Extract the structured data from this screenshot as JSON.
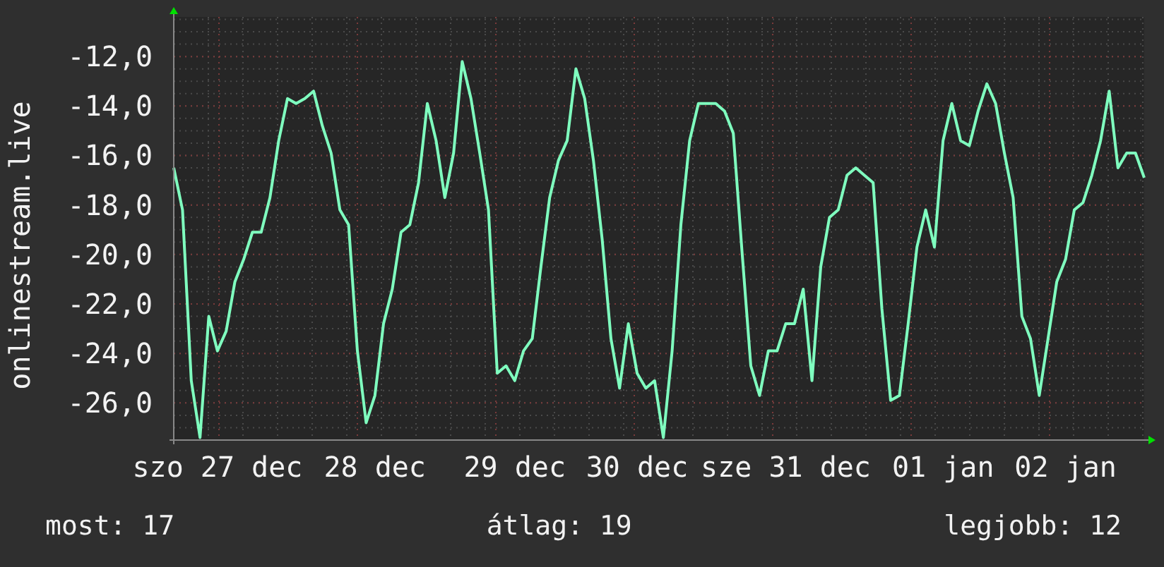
{
  "chart_data": {
    "type": "line",
    "ylabel": "onlinestream.live",
    "grid": true,
    "ylim": [
      -27.5,
      -10.4
    ],
    "yticks": [
      {
        "value": -12,
        "label": "-12,0"
      },
      {
        "value": -14,
        "label": "-14,0"
      },
      {
        "value": -16,
        "label": "-16,0"
      },
      {
        "value": -18,
        "label": "-18,0"
      },
      {
        "value": -20,
        "label": "-20,0"
      },
      {
        "value": -22,
        "label": "-22,0"
      },
      {
        "value": -24,
        "label": "-24,0"
      },
      {
        "value": -26,
        "label": "-26,0"
      }
    ],
    "categories": [
      null,
      null,
      null,
      null,
      null,
      "szo 27 dec",
      null,
      null,
      null,
      null,
      null,
      null,
      null,
      null,
      null,
      null,
      null,
      null,
      null,
      null,
      null,
      null,
      null,
      "28 dec",
      null,
      null,
      null,
      null,
      null,
      null,
      null,
      null,
      null,
      null,
      null,
      null,
      null,
      null,
      null,
      "29 dec",
      null,
      null,
      null,
      null,
      null,
      null,
      null,
      null,
      null,
      null,
      null,
      null,
      null,
      "30 dec",
      null,
      null,
      null,
      null,
      null,
      null,
      null,
      null,
      null,
      null,
      null,
      null,
      null,
      null,
      null,
      null,
      "sze 31 dec",
      null,
      null,
      null,
      null,
      null,
      null,
      null,
      null,
      null,
      null,
      null,
      null,
      null,
      null,
      null,
      null,
      null,
      "01 jan",
      null,
      null,
      null,
      null,
      null,
      null,
      null,
      null,
      null,
      null,
      null,
      null,
      null,
      "02 jan",
      null,
      null,
      null,
      null,
      null,
      null,
      null,
      null,
      null
    ],
    "series": [
      {
        "color": "#7fffbf",
        "values": [
          -16.5,
          -18.2,
          -25.1,
          -27.4,
          -22.5,
          -23.9,
          -23.1,
          -21.1,
          -20.2,
          -19.1,
          -19.1,
          -17.7,
          -15.4,
          -13.7,
          -13.9,
          -13.7,
          -13.4,
          -14.8,
          -15.9,
          -18.2,
          -18.8,
          -23.9,
          -26.8,
          -25.7,
          -22.8,
          -21.4,
          -19.1,
          -18.8,
          -17.1,
          -13.9,
          -15.4,
          -17.7,
          -15.9,
          -12.2,
          -13.7,
          -15.9,
          -18.2,
          -24.8,
          -24.5,
          -25.1,
          -23.9,
          -23.4,
          -20.5,
          -17.7,
          -16.2,
          -15.4,
          -12.5,
          -13.7,
          -16.2,
          -19.4,
          -23.4,
          -25.4,
          -22.8,
          -24.8,
          -25.4,
          -25.1,
          -27.4,
          -23.9,
          -18.8,
          -15.4,
          -13.9,
          -13.9,
          -13.9,
          -14.2,
          -15.1,
          -19.9,
          -24.5,
          -25.7,
          -23.9,
          -23.9,
          -22.8,
          -22.8,
          -21.4,
          -25.1,
          -20.5,
          -18.5,
          -18.2,
          -16.8,
          -16.5,
          -16.8,
          -17.1,
          -22.2,
          -25.9,
          -25.7,
          -22.8,
          -19.7,
          -18.2,
          -19.7,
          -15.4,
          -13.9,
          -15.4,
          -15.6,
          -14.2,
          -13.1,
          -13.9,
          -15.9,
          -17.7,
          -22.5,
          -23.4,
          -25.7,
          -23.4,
          -21.1,
          -20.2,
          -18.2,
          -17.9,
          -16.8,
          -15.4,
          -13.4,
          -16.5,
          -15.9,
          -15.9,
          -16.9
        ]
      }
    ]
  },
  "legend": [
    {
      "label": "most: 17"
    },
    {
      "label": "átlag: 19"
    },
    {
      "label": "legjobb: 12"
    }
  ]
}
